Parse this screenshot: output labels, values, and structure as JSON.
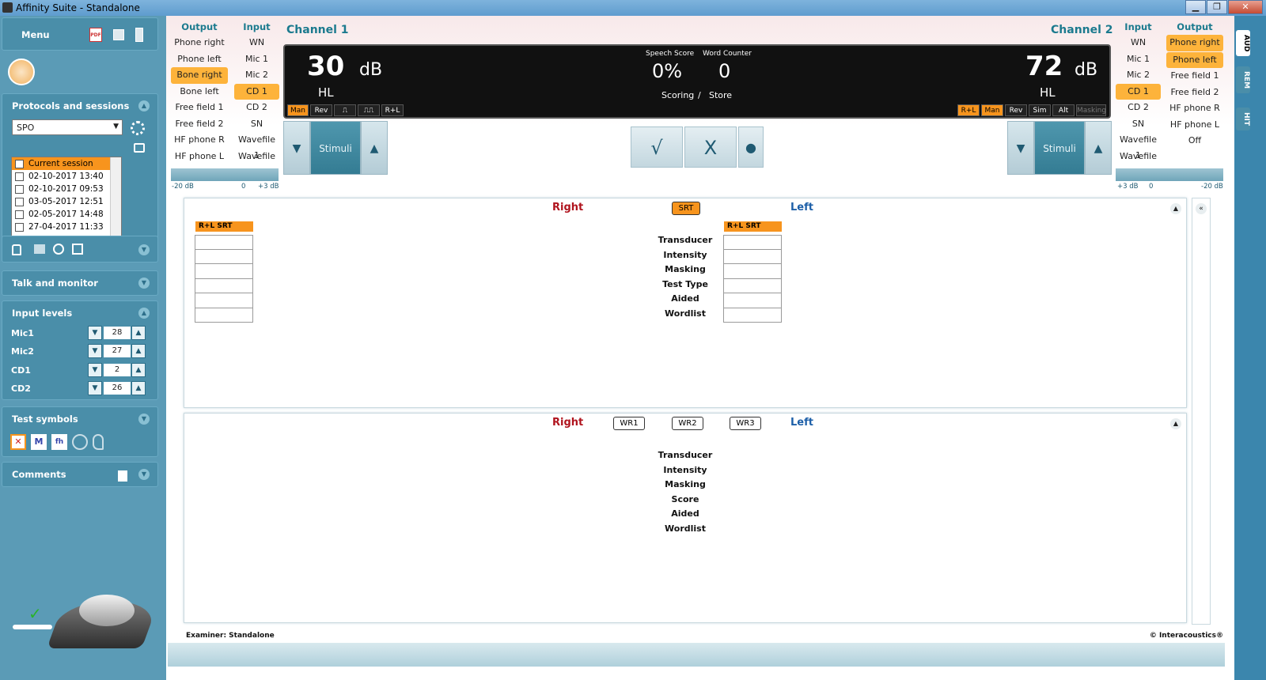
{
  "window": {
    "title": "Affinity Suite - Standalone",
    "min": "▁",
    "max": "❐",
    "close": "✕"
  },
  "left": {
    "menu_label": "Menu",
    "pdf_label": "PDF",
    "protocols_header": "Protocols and sessions",
    "protocol_value": "SPO",
    "sessions": [
      "Current session",
      "02-10-2017 13:40",
      "02-10-2017 09:53",
      "03-05-2017 12:51",
      "02-05-2017 14:48",
      "27-04-2017 11:33"
    ],
    "talk_header": "Talk and monitor",
    "input_levels_header": "Input levels",
    "levels": [
      {
        "name": "Mic1",
        "value": "28"
      },
      {
        "name": "Mic2",
        "value": "27"
      },
      {
        "name": "CD1",
        "value": "2"
      },
      {
        "name": "CD2",
        "value": "26"
      }
    ],
    "test_symbols_header": "Test symbols",
    "comments_header": "Comments"
  },
  "ch1": {
    "title": "Channel 1",
    "output_head": "Output",
    "input_head": "Input",
    "outputs": [
      "Phone right",
      "Phone left",
      "Bone right",
      "Bone left",
      "Free field 1",
      "Free field 2",
      "HF phone R",
      "HF phone L"
    ],
    "outputs_selected": "Bone right",
    "inputs": [
      "WN",
      "Mic 1",
      "Mic 2",
      "CD 1",
      "CD 2",
      "SN",
      "Wavefile 1",
      "Wavefile 2"
    ],
    "inputs_selected": "CD 1",
    "value": "30",
    "unit": "dB",
    "hl": "HL",
    "modes": [
      "Man",
      "Rev",
      "⎍",
      "⎍⎍",
      "R+L"
    ],
    "stimuli": "Stimuli",
    "slider": {
      "min": "-20 dB",
      "zero": "0",
      "max": "+3 dB"
    }
  },
  "ch2": {
    "title": "Channel 2",
    "output_head": "Output",
    "input_head": "Input",
    "inputs": [
      "WN",
      "Mic 1",
      "Mic 2",
      "CD 1",
      "CD 2",
      "SN",
      "Wavefile 1",
      "Wavefile 2"
    ],
    "inputs_selected": "CD 1",
    "outputs": [
      "Phone right",
      "Phone left",
      "Free field 1",
      "Free field 2",
      "HF phone R",
      "HF phone L",
      "Off"
    ],
    "outputs_selected": [
      "Phone right",
      "Phone left"
    ],
    "value": "72",
    "unit": "dB",
    "hl": "HL",
    "modes": [
      "R+L",
      "Man",
      "Rev",
      "Sim",
      "Alt",
      "Masking"
    ],
    "stimuli": "Stimuli",
    "slider": {
      "min": "+3 dB",
      "zero": "0",
      "max": "-20 dB"
    }
  },
  "center_display": {
    "speech_score_label": "Speech Score",
    "word_counter_label": "Word Counter",
    "speech_score": "0%",
    "word_counter": "0",
    "scoring_label": "Scoring",
    "slash": "/",
    "store_label": "Store"
  },
  "score_buttons": {
    "correct": "√",
    "wrong": "X",
    "record": "●"
  },
  "srt_panel": {
    "right": "Right",
    "left": "Left",
    "tab": "SRT",
    "right_tag": "R+L SRT",
    "left_tag": "R+L SRT",
    "rows": [
      "Transducer",
      "Intensity",
      "Masking",
      "Test Type",
      "Aided",
      "Wordlist"
    ]
  },
  "wr_panel": {
    "right": "Right",
    "left": "Left",
    "tabs": [
      "WR1",
      "WR2",
      "WR3"
    ],
    "rows": [
      "Transducer",
      "Intensity",
      "Masking",
      "Score",
      "Aided",
      "Wordlist"
    ]
  },
  "footer": {
    "examiner": "Examiner: Standalone",
    "copyright": "© Interacoustics®"
  },
  "side_tabs": [
    "AUD",
    "REM",
    "HIT"
  ],
  "colors": {
    "accent": "#f7941d",
    "teal": "#1b7a8e",
    "right": "#b0141e",
    "left": "#1d5fa8",
    "panel": "#4a8ea9"
  }
}
